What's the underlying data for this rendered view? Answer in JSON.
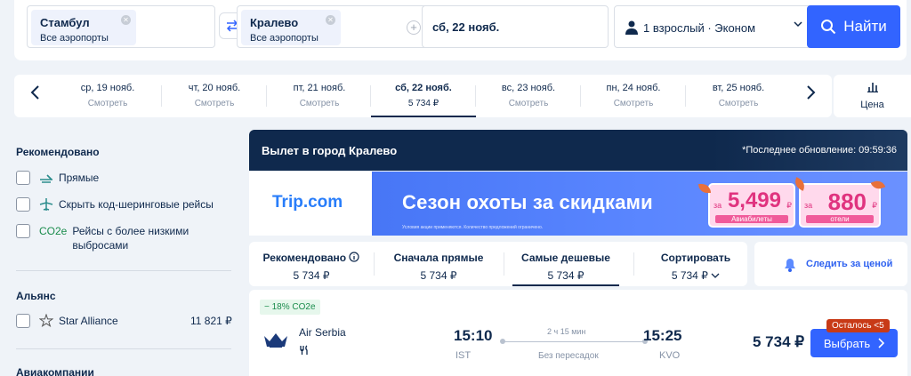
{
  "search": {
    "origin": {
      "city": "Стамбул",
      "airports": "Все аэропорты"
    },
    "destination": {
      "city": "Кралево",
      "airports": "Все аэропорты"
    },
    "date": "сб, 22 нояб.",
    "passengers": "1 взрослый · Эконом",
    "search_button": "Найти"
  },
  "date_strip": {
    "dates": [
      {
        "label": "ср, 19 нояб.",
        "value": "Смотреть"
      },
      {
        "label": "чт, 20 нояб.",
        "value": "Смотреть"
      },
      {
        "label": "пт, 21 нояб.",
        "value": "Смотреть"
      },
      {
        "label": "сб, 22 нояб.",
        "value": "5 734 ₽",
        "active": true
      },
      {
        "label": "вс, 23 нояб.",
        "value": "Смотреть"
      },
      {
        "label": "пн, 24 нояб.",
        "value": "Смотреть"
      },
      {
        "label": "вт, 25 нояб.",
        "value": "Смотреть"
      }
    ],
    "price_toggle": "Цена"
  },
  "sidebar": {
    "recommended_heading": "Рекомендовано",
    "filters": [
      {
        "label": "Прямые",
        "icon": "direct-flight-icon"
      },
      {
        "label": "Скрыть код-шеринговые рейсы",
        "icon": "codeshare-plane-icon"
      },
      {
        "tag": "CO2e",
        "label": "Рейсы с более низкими выбросами"
      }
    ],
    "alliance_heading": "Альянс",
    "alliances": [
      {
        "label": "Star Alliance",
        "price": "11 821 ₽",
        "icon": "star-alliance-icon"
      }
    ],
    "airlines_heading": "Авиакомпании"
  },
  "results": {
    "header_title": "Вылет в город Кралево",
    "last_update": "*Последнее обновление: 09:59:36",
    "ad": {
      "logo": "Trip.com",
      "headline": "Сезон охоты за  скидками",
      "fine_print": "Условия акции применяются. Количество предложений ограничено.",
      "promo_flights_from": "за",
      "promo_flights_value": "5,499",
      "promo_flights_currency": "₽",
      "promo_flights_caption": "Авиабилеты",
      "promo_hotels_from": "за",
      "promo_hotels_value": "880",
      "promo_hotels_currency": "₽",
      "promo_hotels_caption": "отели"
    },
    "sort_tabs": [
      {
        "label": "Рекомендовано",
        "value": "5 734 ₽",
        "info_icon": true
      },
      {
        "label": "Сначала прямые",
        "value": "5 734 ₽"
      },
      {
        "label": "Самые дешевые",
        "value": "5 734 ₽",
        "active": true
      },
      {
        "label": "Сортировать",
        "value": "5 734 ₽",
        "dropdown": true
      }
    ],
    "track_price": "Следить за ценой",
    "flight": {
      "co2_badge": "− 18% CO2e",
      "airline": "Air Serbia",
      "departure_time": "15:10",
      "departure_airport": "IST",
      "duration": "2 ч 15 мин",
      "stops": "Без пересадок",
      "arrival_time": "15:25",
      "arrival_airport": "KVO",
      "price": "5 734 ₽",
      "availability": "Осталось <5",
      "select_button": "Выбрать"
    }
  },
  "colors": {
    "accent": "#3264ff",
    "navy": "#0f294d",
    "green": "#1a8c4c",
    "badge_red": "#c83a16"
  }
}
